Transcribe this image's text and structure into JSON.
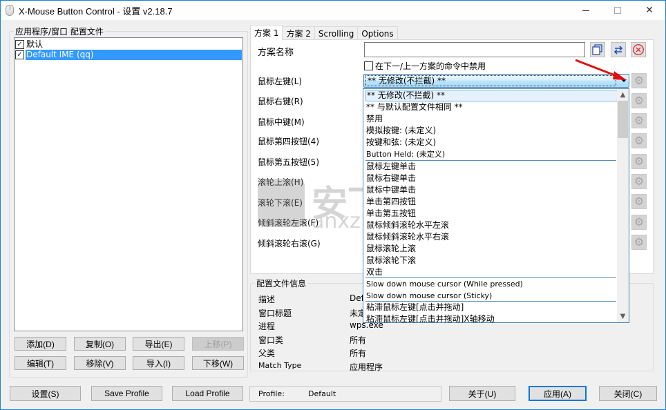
{
  "window": {
    "title": "X-Mouse Button Control - 设置 v2.18.7",
    "controls": {
      "minimize": "minimize",
      "maximize": "maximize",
      "close": "close"
    }
  },
  "profiles": {
    "group_label": "应用程序/窗口 配置文件",
    "items": [
      {
        "label": "默认",
        "checked": true,
        "selected": false
      },
      {
        "label": "Default IME (qq)",
        "checked": true,
        "selected": true
      }
    ],
    "buttons": {
      "add": "添加(D)",
      "copy": "复制(O)",
      "export": "导出(E)",
      "move_up": "上移(P)",
      "edit": "编辑(T)",
      "remove": "移除(V)",
      "import": "导入(I)",
      "move_down": "下移(W)"
    }
  },
  "tabs": [
    {
      "label": "方案 1",
      "active": true
    },
    {
      "label": "方案 2",
      "active": false
    },
    {
      "label": "Scrolling",
      "active": false
    },
    {
      "label": "Options",
      "active": false
    }
  ],
  "scheme": {
    "name_label": "方案名称",
    "name_value": "",
    "disable_checkbox_label": "在下一/上一方案的命令中禁用",
    "disable_checked": false,
    "icon_buttons": [
      "copy-scheme",
      "swap-scheme",
      "clear-scheme"
    ],
    "buttons": [
      {
        "label": "鼠标左键(L)",
        "value": "** 无修改(不拦截) **"
      },
      {
        "label": "鼠标右键(R)",
        "value": ""
      },
      {
        "label": "鼠标中键(M)",
        "value": ""
      },
      {
        "label": "鼠标第四按钮(4)",
        "value": ""
      },
      {
        "label": "鼠标第五按钮(5)",
        "value": ""
      },
      {
        "label": "滚轮上滚(H)",
        "value": ""
      },
      {
        "label": "滚轮下滚(E)",
        "value": ""
      },
      {
        "label": "倾斜滚轮左滚(F)",
        "value": ""
      },
      {
        "label": "倾斜滚轮右滚(G)",
        "value": ""
      }
    ]
  },
  "dropdown": {
    "options": [
      "** 无修改(不拦截) **",
      "** 与默认配置文件相同 **",
      "禁用",
      "模拟按键: (未定义)",
      "按键和弦: (未定义)",
      "Button Held: (未定义)",
      "鼠标左键单击",
      "鼠标右键单击",
      "鼠标中键单击",
      "单击第四按钮",
      "单击第五按钮",
      "鼠标倾斜滚轮水平左滚",
      "鼠标倾斜滚轮水平右滚",
      "鼠标滚轮上滚",
      "鼠标滚轮下滚",
      "双击",
      "Slow down mouse cursor (While pressed)",
      "Slow down mouse cursor (Sticky)",
      "粘滞鼠标左键[点击并拖动]",
      "粘滞鼠标左键[点击并拖动]X轴移动"
    ],
    "selected_index": 0
  },
  "profile_info": {
    "group_label": "配置文件信息",
    "rows": [
      {
        "label": "描述",
        "value": "Defa"
      },
      {
        "label": "窗口标题",
        "value": "未定"
      },
      {
        "label": "进程",
        "value": "wps.exe"
      },
      {
        "label": "窗口类",
        "value": "所有"
      },
      {
        "label": "父类",
        "value": "所有"
      },
      {
        "label": "Match Type",
        "value": "应用程序"
      }
    ]
  },
  "footer": {
    "settings": "设置(S)",
    "save_profile": "Save Profile",
    "load_profile": "Load Profile",
    "status_label": "Profile:",
    "status_value": "Default",
    "about": "关于(U)",
    "apply": "应用(A)",
    "close": "关闭(C)"
  },
  "watermark": {
    "text": "安下",
    "sub": "anxz.com"
  }
}
